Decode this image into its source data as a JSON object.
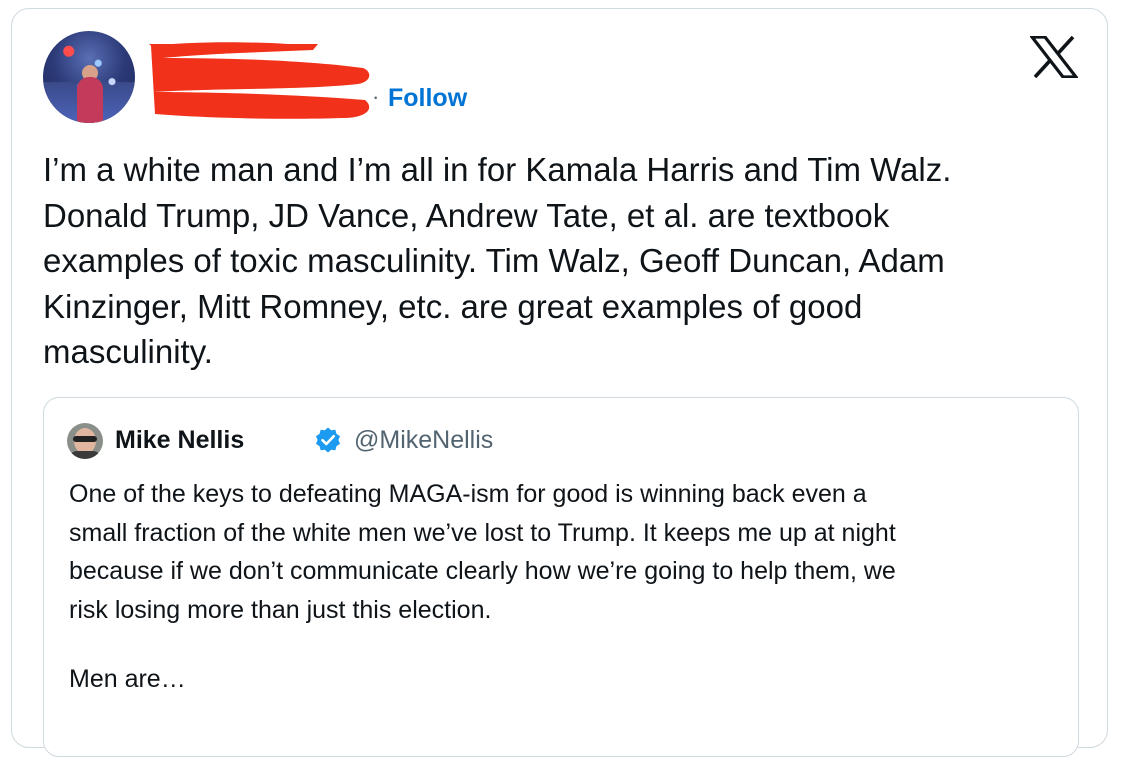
{
  "post": {
    "author_name_redacted": true,
    "follow_label": "Follow",
    "separator": "·",
    "text_lines": [
      "I’m a white man and I’m all in for Kamala Harris and Tim Walz.",
      "Donald Trump, JD Vance, Andrew Tate, et al. are textbook",
      "examples of toxic masculinity. Tim Walz, Geoff Duncan, Adam",
      "Kinzinger, Mitt Romney, etc. are great examples of good",
      "masculinity."
    ]
  },
  "quoted": {
    "author": "Mike Nellis",
    "handle": "@MikeNellis",
    "verified": true,
    "text_lines": [
      "One of the keys to defeating MAGA-ism for good is winning back even a",
      "small fraction of the white men we’ve lost to Trump. It keeps me up at night",
      "because if we don’t communicate clearly how we’re going to help them, we",
      "risk losing more than just this election."
    ],
    "truncated_line": "Men are…"
  },
  "icons": {
    "brand": "x-logo-icon",
    "verified": "verified-badge-icon"
  },
  "colors": {
    "follow_blue": "#0074d4",
    "verified_blue": "#1d9bf0",
    "redaction_red": "#f2311b",
    "border": "#cfd9de",
    "secondary_text": "#536471"
  }
}
